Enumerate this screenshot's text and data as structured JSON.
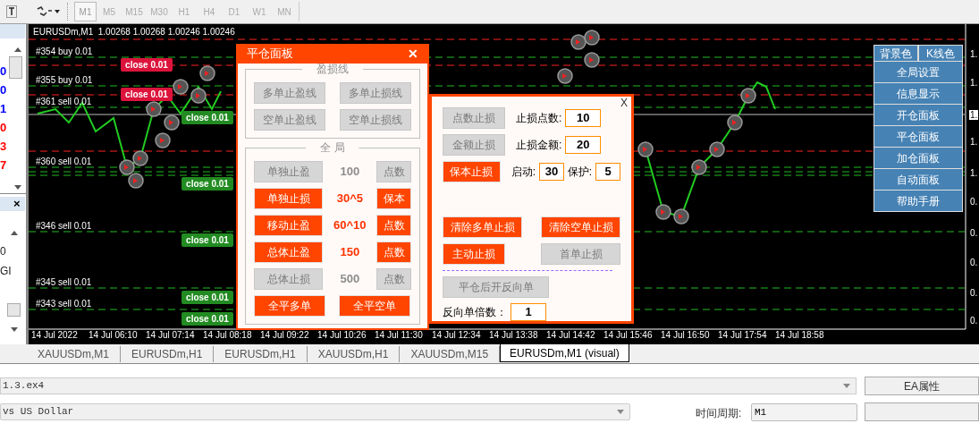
{
  "toolbar": {
    "timeframes": [
      {
        "label": "M1",
        "selected": true
      },
      {
        "label": "M5",
        "selected": false
      },
      {
        "label": "M15",
        "selected": false
      },
      {
        "label": "M30",
        "selected": false
      },
      {
        "label": "H1",
        "selected": false
      },
      {
        "label": "H4",
        "selected": false
      },
      {
        "label": "D1",
        "selected": false
      },
      {
        "label": "W1",
        "selected": false
      },
      {
        "label": "MN",
        "selected": false
      }
    ]
  },
  "left_panels": {
    "upper_values": [
      {
        "text": "0",
        "color": "#0000ff"
      },
      {
        "text": "0",
        "color": "#0000ff"
      },
      {
        "text": "1",
        "color": "#0000ff"
      },
      {
        "text": "0",
        "color": "#ff0000"
      },
      {
        "text": "3",
        "color": "#ff0000"
      },
      {
        "text": "7",
        "color": "#ff0000"
      }
    ],
    "close_label": "×",
    "lower_values": [
      "0",
      "GI"
    ]
  },
  "chart": {
    "header": "EURUSDm,M1  1.00268 1.00268 1.00246 1.00246",
    "order_labels": [
      "#354 buy 0.01",
      "#355 buy 0.01",
      "#361 sell 0.01",
      "#360 sell 0.01",
      "#346 sell 0.01",
      "#345 sell 0.01",
      "#343 sell 0.01"
    ],
    "close_buttons": [
      {
        "label": "close 0.01",
        "color": "#dc143c"
      },
      {
        "label": "close 0.01",
        "color": "#dc143c"
      },
      {
        "label": "close 0.01",
        "color": "#228b22"
      },
      {
        "label": "close 0.01",
        "color": "#228b22"
      },
      {
        "label": "close 0.01",
        "color": "#228b22"
      },
      {
        "label": "close 0.01",
        "color": "#228b22"
      },
      {
        "label": "close 0.01",
        "color": "#228b22"
      }
    ],
    "price_labels": [
      "1.",
      "1.",
      "1.",
      "1.",
      "1.",
      "0.",
      "0.",
      "0.",
      "0.",
      "0."
    ],
    "time_labels": [
      "14 Jul 2022",
      "14 Jul 06:10",
      "14 Jul 07:14",
      "14 Jul 08:18",
      "14 Jul 09:22",
      "14 Jul 10:26",
      "14 Jul 11:30",
      "14 Jul 12:34",
      "14 Jul 13:38",
      "14 Jul 14:42",
      "14 Jul 15:46",
      "14 Jul 16:50",
      "14 Jul 17:54",
      "14 Jul 18:58"
    ]
  },
  "close_panel": {
    "title": "平仓面板",
    "close_label": "✕",
    "line_section": {
      "title": "盈损线",
      "buttons": [
        {
          "label": "多单止盈线",
          "disabled": true
        },
        {
          "label": "多单止损线",
          "disabled": true
        },
        {
          "label": "空单止盈线",
          "disabled": true
        },
        {
          "label": "空单止损线",
          "disabled": true
        }
      ]
    },
    "global_section": {
      "title": "全 局",
      "rows": [
        {
          "kind": "setting",
          "button": {
            "label": "单独止盈",
            "disabled": true
          },
          "value": "100",
          "unit": {
            "label": "点数",
            "disabled": true
          }
        },
        {
          "kind": "setting",
          "button": {
            "label": "单独止损",
            "disabled": false
          },
          "value": "30^5",
          "unit": {
            "label": "保本",
            "disabled": false
          }
        },
        {
          "kind": "setting",
          "button": {
            "label": "移动止盈",
            "disabled": false
          },
          "value": "60^10",
          "unit": {
            "label": "点数",
            "disabled": false
          }
        },
        {
          "kind": "setting",
          "button": {
            "label": "总体止盈",
            "disabled": false
          },
          "value": "150",
          "unit": {
            "label": "点数",
            "disabled": false
          }
        },
        {
          "kind": "setting",
          "button": {
            "label": "总体止损",
            "disabled": true
          },
          "value": "500",
          "unit": {
            "label": "点数",
            "disabled": true
          }
        },
        {
          "kind": "pair",
          "buttons": [
            {
              "label": "全平多单",
              "disabled": false
            },
            {
              "label": "全平空单",
              "disabled": false
            }
          ]
        }
      ]
    }
  },
  "stop_panel": {
    "close_label": "X",
    "rows": [
      {
        "kind": "field",
        "button": {
          "label": "点数止损",
          "disabled": true
        },
        "fields": [
          {
            "label": "止损点数:",
            "value": "10"
          }
        ]
      },
      {
        "kind": "field",
        "button": {
          "label": "金额止损",
          "disabled": true
        },
        "fields": [
          {
            "label": "止损金额:",
            "value": "20"
          }
        ]
      },
      {
        "kind": "field",
        "button": {
          "label": "保本止损",
          "disabled": false
        },
        "fields": [
          {
            "label": "启动:",
            "value": "30"
          },
          {
            "label": "保护:",
            "value": "5"
          }
        ]
      },
      {
        "kind": "spacer"
      },
      {
        "kind": "buttons",
        "buttons": [
          {
            "label": "清除多单止损",
            "disabled": false
          },
          {
            "label": "清除空单止损",
            "disabled": false
          }
        ]
      },
      {
        "kind": "buttons",
        "buttons": [
          {
            "label": "主动止损",
            "disabled": false
          },
          {
            "label": "首单止损",
            "disabled": true
          }
        ]
      },
      {
        "kind": "divider"
      },
      {
        "kind": "buttons",
        "buttons": [
          {
            "label": "平仓后开反向单",
            "disabled": true
          }
        ]
      },
      {
        "kind": "field",
        "fields": [
          {
            "label": "反向单倍数：",
            "value": "1"
          }
        ]
      }
    ]
  },
  "side_menu": {
    "top": [
      "背景色",
      "K线色"
    ],
    "items": [
      "全局设置",
      "信息显示",
      "开仓面板",
      "平仓面板",
      "加仓面板",
      "自动面板",
      "帮助手册"
    ]
  },
  "chart_tabs": [
    {
      "label": "XAUUSDm,M1",
      "selected": false
    },
    {
      "label": "EURUSDm,H1",
      "selected": false
    },
    {
      "label": "EURUSDm,H1",
      "selected": false
    },
    {
      "label": "XAUUSDm,H1",
      "selected": false
    },
    {
      "label": "XAUUSDm,M15",
      "selected": false
    },
    {
      "label": "EURUSDm,M1 (visual)",
      "selected": true
    }
  ],
  "tester": {
    "expert": "1.3.ex4",
    "symbol": "vs US Dollar",
    "period_label": "时间周期:",
    "period": "M1",
    "buttons": [
      "EA属性"
    ]
  }
}
